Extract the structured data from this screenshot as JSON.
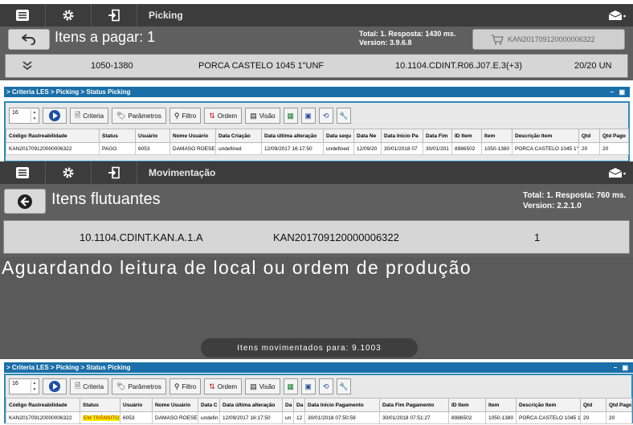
{
  "screen1": {
    "title": "Picking",
    "header_title": "Itens a pagar: 1",
    "info_line1": "Total: 1. Resposta: 1430 ms.",
    "info_line2": "Version: 3.9.6.8",
    "cart_code": "KAN201709120000006322",
    "item": {
      "code": "1050-1380",
      "description": "PORCA CASTELO 1045 1\"UNF",
      "location": "10.1104.CDINT.R06.J07.E.3(+3)",
      "qty": "20/20 UN"
    }
  },
  "les1": {
    "breadcrumb": "> Criteria LES > Picking > Status Picking",
    "page_size": "16",
    "toolbar": {
      "criteria": "Criteria",
      "parametros": "Parâmetros",
      "filtro": "Filtro",
      "ordem": "Ordem",
      "visao": "Visão"
    },
    "columns": [
      "Código Rastreabilidade",
      "Status",
      "Usuário",
      "Nome Usuário",
      "Data Criação",
      "Data última alteração",
      "Data sequ",
      "Data Ne",
      "Data Início Pa",
      "Data Fim",
      "ID Item",
      "Item",
      "Descrição Item",
      "Qtd",
      "Qtd Pago"
    ],
    "rows": [
      [
        "KAN201709120000006322",
        "PAGO",
        "6053",
        "DAMASO ROESE",
        "undefined",
        "12/09/2017 16:17:50",
        "undefined",
        "12/09/20",
        "30/01/2018 07",
        "30/01/201",
        "8986502",
        "1050-1380",
        "PORCA CASTELO 1045 1\"",
        "20",
        "20"
      ]
    ]
  },
  "screen2": {
    "title": "Movimentação",
    "header_title": "Itens flutuantes",
    "info_line1": "Total: 1. Resposta: 760 ms.",
    "info_line2": "Version: 2.2.1.0",
    "item": {
      "location": "10.1104.CDINT.KAN.A.1.A",
      "code": "KAN201709120000006322",
      "qty": "1"
    },
    "waiting_message": "Aguardando leitura de local ou ordem de produção",
    "toast": "Itens movimentados para: 9.1003"
  },
  "les2": {
    "breadcrumb": "> Criteria LES > Picking > Status Picking",
    "page_size": "16",
    "toolbar": {
      "criteria": "Criteria",
      "parametros": "Parâmetros",
      "filtro": "Filtro",
      "ordem": "Ordem",
      "visao": "Visão"
    },
    "columns": [
      "Código Rastreabilidade",
      "Status",
      "Usuário",
      "Nome Usuário",
      "Data C",
      "Data última alteração",
      "Da",
      "Da",
      "Data Início Pagamento",
      "Data Fim Pagamento",
      "ID Item",
      "Item",
      "Descrição Item",
      "Qtd",
      "Qtd Pago"
    ],
    "rows": [
      [
        "KAN201709120000006322",
        "EM TRÂNSITO",
        "6053",
        "DAMASO ROESE",
        "undefin",
        "12/09/2017 16:17:50",
        "un",
        "12",
        "30/01/2018 07:50:59",
        "30/01/2018 07:51:27",
        "8986502",
        "1050-1380",
        "PORCA CASTELO 1045 1",
        "20",
        "20"
      ]
    ]
  },
  "icons": {
    "menu": "list-icon",
    "settings": "gear-icon",
    "logout": "exit-icon",
    "mail": "envelope-icon",
    "back": "back-arrow-icon",
    "cart": "cart-icon"
  },
  "colors": {
    "les_bar": "#1b6fa8",
    "status_highlight": "#f6f000",
    "dark_bar": "#3c3c3c"
  }
}
